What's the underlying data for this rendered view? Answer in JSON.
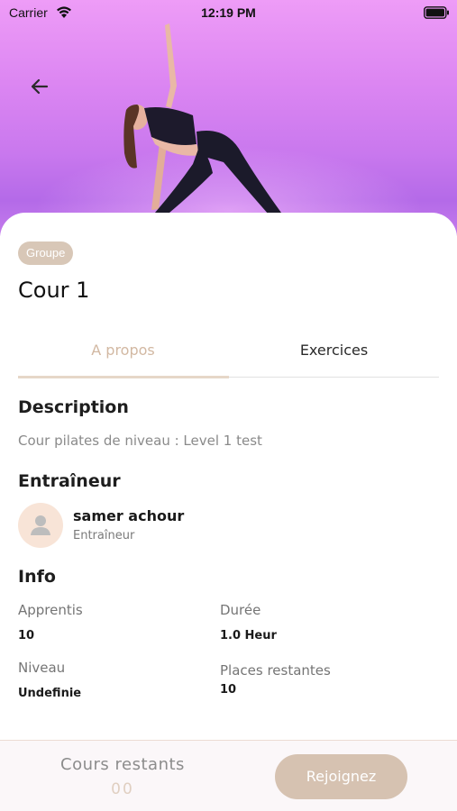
{
  "status_bar": {
    "carrier": "Carrier",
    "time": "12:19 PM"
  },
  "header": {
    "back_icon": "arrow-left-icon"
  },
  "course": {
    "badge": "Groupe",
    "title": "Cour 1"
  },
  "tabs": [
    {
      "label": "A propos",
      "active": true
    },
    {
      "label": "Exercices",
      "active": false
    }
  ],
  "description": {
    "heading": "Description",
    "text": "Cour pilates de niveau : Level 1 test"
  },
  "coach": {
    "heading": "Entraîneur",
    "name": "samer achour",
    "role": "Entraîneur",
    "avatar_icon": "user-icon"
  },
  "info": {
    "heading": "Info",
    "apprentis_label": "Apprentis",
    "apprentis_value": "10",
    "duree_label": "Durée",
    "duree_value": "1.0 Heur",
    "niveau_label": "Niveau",
    "niveau_value": "Undefinie",
    "places_label": "Places restantes",
    "places_value": "10"
  },
  "footer": {
    "label": "Cours restants",
    "count": "00",
    "join_label": "Rejoignez"
  },
  "colors": {
    "accent": "#d6c2b1",
    "tab_active": "#d2b8a2",
    "hero": "#dc86f2"
  }
}
